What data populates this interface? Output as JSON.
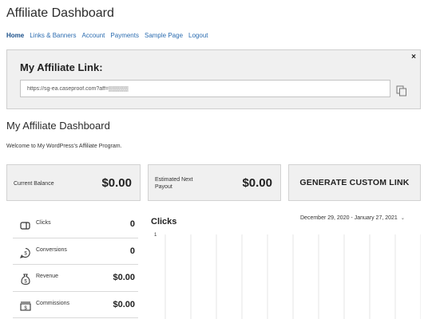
{
  "page": {
    "title": "Affiliate Dashboard"
  },
  "nav": {
    "items": [
      {
        "label": "Home"
      },
      {
        "label": "Links & Banners"
      },
      {
        "label": "Account"
      },
      {
        "label": "Payments"
      },
      {
        "label": "Sample Page"
      },
      {
        "label": "Logout"
      }
    ]
  },
  "link_box": {
    "heading": "My Affiliate Link:",
    "url": "https://sg-ea.caseproof.com?aff=▒▒▒▒▒",
    "close": "×"
  },
  "dashboard": {
    "title": "My Affiliate Dashboard",
    "welcome": "Welcome to My WordPress's Affiliate Program."
  },
  "cards": {
    "balance_label": "Current Balance",
    "balance_value": "$0.00",
    "payout_label": "Estimated Next Payout",
    "payout_value": "$0.00",
    "custom_link_label": "GENERATE CUSTOM LINK"
  },
  "stats": [
    {
      "label": "Clicks",
      "value": "0",
      "icon": "clicks-icon"
    },
    {
      "label": "Conversions",
      "value": "0",
      "icon": "conversions-icon"
    },
    {
      "label": "Revenue",
      "value": "$0.00",
      "icon": "revenue-icon"
    },
    {
      "label": "Commissions",
      "value": "$0.00",
      "icon": "commissions-icon"
    }
  ],
  "chart": {
    "title": "Clicks",
    "date_range": "December 29, 2020 - January 27, 2021"
  },
  "chart_data": {
    "type": "line",
    "title": "Clicks",
    "xlabel": "",
    "ylabel": "",
    "ylim": [
      0,
      1
    ],
    "ytick_labels": [
      "1"
    ],
    "series": [
      {
        "values": []
      }
    ],
    "grid": true
  }
}
